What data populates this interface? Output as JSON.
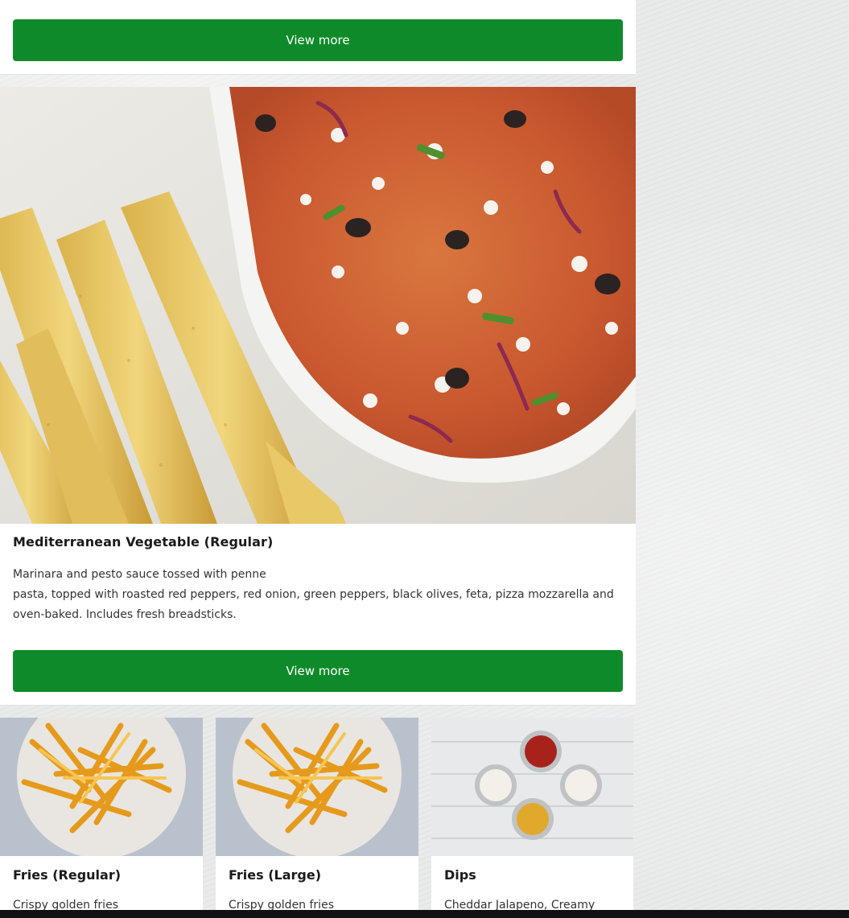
{
  "top_card": {
    "view_more_label": "View more"
  },
  "featured": {
    "image_alt": "Mediterranean vegetable pasta with breadsticks",
    "title": "Mediterranean Vegetable (Regular)",
    "description_line1": "Marinara and pesto sauce tossed with penne",
    "description_rest": "pasta, topped with roasted red peppers, red onion, green peppers, black olives, feta, pizza mozzarella and oven-baked. Includes fresh breadsticks.",
    "view_more_label": "View more"
  },
  "items": [
    {
      "title": "Fries (Regular)",
      "description": "Crispy golden fries"
    },
    {
      "title": "Fries (Large)",
      "description": "Crispy golden fries"
    },
    {
      "title": "Dips",
      "description": "Cheddar Jalapeno, Creamy"
    }
  ],
  "colors": {
    "primary_button": "#0f8a2a",
    "page_background": "#e9eaea"
  }
}
